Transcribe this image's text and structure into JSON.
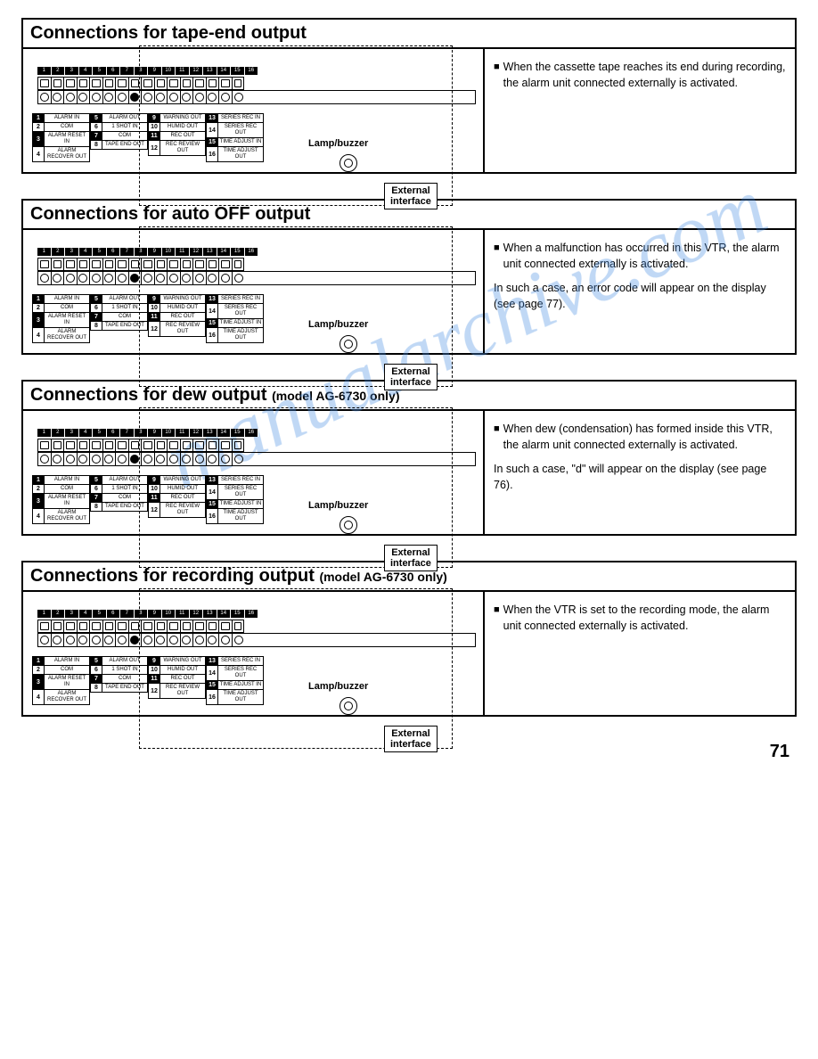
{
  "page_number": "71",
  "watermark": "manualarchive.com",
  "terminal_numbers": [
    "1",
    "2",
    "3",
    "4",
    "5",
    "6",
    "7",
    "8",
    "9",
    "10",
    "11",
    "12",
    "13",
    "14",
    "15",
    "16"
  ],
  "filled_circle_index": 7,
  "pin_map": [
    [
      {
        "n": "1",
        "inv": true,
        "label": "ALARM IN"
      },
      {
        "n": "2",
        "inv": false,
        "label": "COM"
      },
      {
        "n": "3",
        "inv": true,
        "label": "ALARM RESET IN"
      },
      {
        "n": "4",
        "inv": false,
        "label": "ALARM RECOVER OUT"
      }
    ],
    [
      {
        "n": "5",
        "inv": true,
        "label": "ALARM OUT"
      },
      {
        "n": "6",
        "inv": false,
        "label": "1 SHOT IN"
      },
      {
        "n": "7",
        "inv": true,
        "label": "COM"
      },
      {
        "n": "8",
        "inv": false,
        "label": "TAPE END OUT"
      }
    ],
    [
      {
        "n": "9",
        "inv": true,
        "label": "WARNING OUT"
      },
      {
        "n": "10",
        "inv": false,
        "label": "HUMID OUT"
      },
      {
        "n": "11",
        "inv": true,
        "label": "REC OUT"
      },
      {
        "n": "12",
        "inv": false,
        "label": "REC REVIEW OUT"
      }
    ],
    [
      {
        "n": "13",
        "inv": true,
        "label": "SERIES REC IN"
      },
      {
        "n": "14",
        "inv": false,
        "label": "SERIES REC OUT"
      },
      {
        "n": "15",
        "inv": true,
        "label": "TIME ADJUST IN"
      },
      {
        "n": "16",
        "inv": false,
        "label": "TIME ADJUST OUT"
      }
    ]
  ],
  "lamp_label": "Lamp/buzzer",
  "ext_if_l1": "External",
  "ext_if_l2": "interface",
  "sections": [
    {
      "title": "Connections for tape-end output",
      "sub": "",
      "desc": [
        {
          "bullet": true,
          "text": "When the cassette tape reaches its end during recording, the alarm unit connected externally is activated."
        }
      ]
    },
    {
      "title": "Connections for auto OFF output",
      "sub": "",
      "desc": [
        {
          "bullet": true,
          "text": "When a malfunction has occurred in this VTR, the alarm unit connected externally is activated."
        },
        {
          "bullet": false,
          "text": "In such a case, an error code will appear on the display (see page 77)."
        }
      ]
    },
    {
      "title": "Connections for dew output",
      "sub": "(model AG-6730 only)",
      "desc": [
        {
          "bullet": true,
          "text": "When dew (condensation) has formed inside this VTR, the alarm unit connected externally is activated."
        },
        {
          "bullet": false,
          "text": "In such a case, \"d\" will appear on the display (see page 76)."
        }
      ]
    },
    {
      "title": "Connections for recording output",
      "sub": "(model AG-6730 only)",
      "desc": [
        {
          "bullet": true,
          "text": "When the VTR is set to the recording mode, the alarm unit connected externally is activated."
        }
      ]
    }
  ]
}
